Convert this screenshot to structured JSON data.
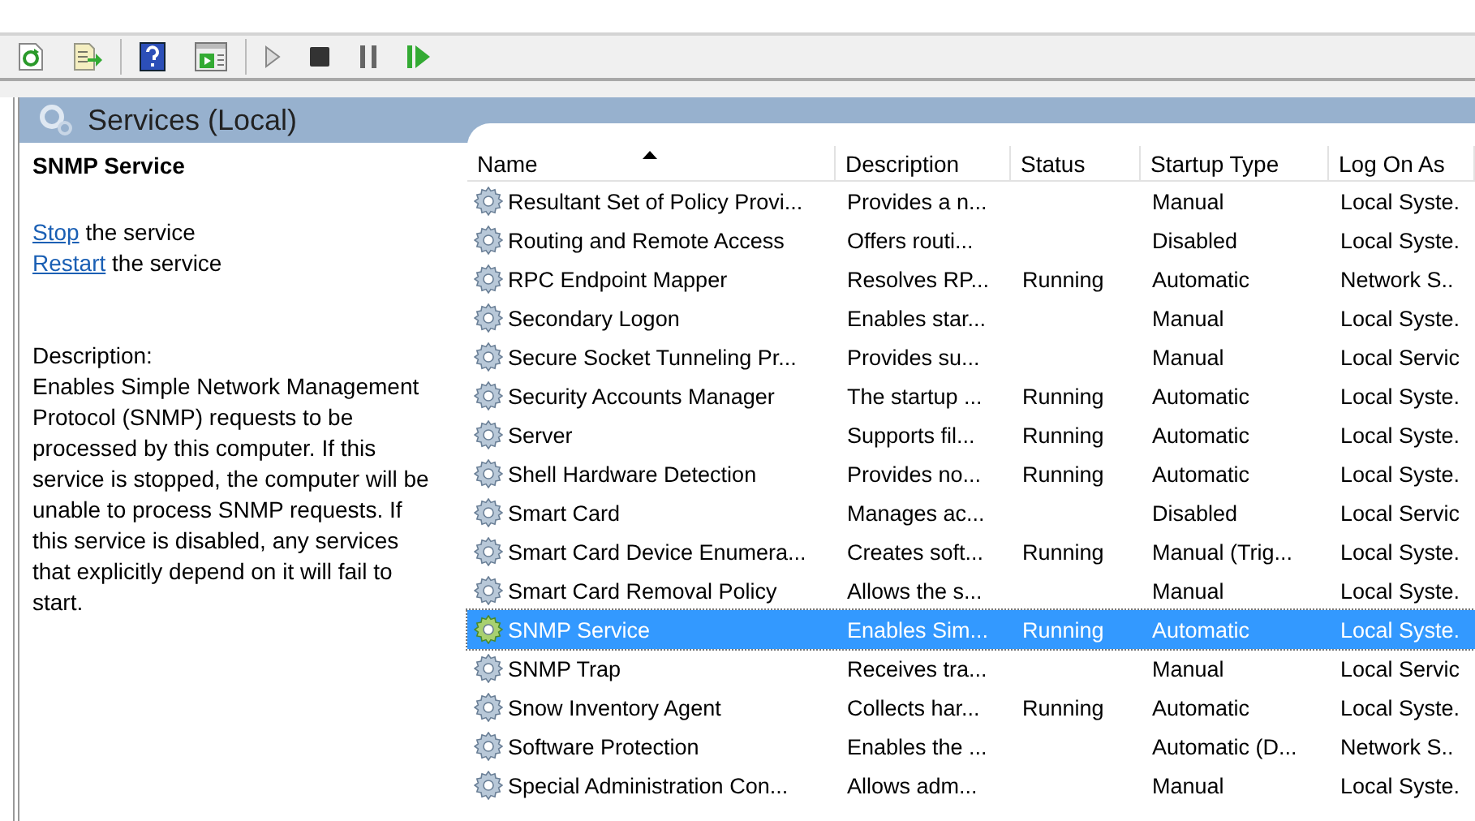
{
  "toolbar": {
    "buttons": [
      {
        "kind": "refresh"
      },
      {
        "kind": "export"
      },
      {
        "kind": "help"
      },
      {
        "kind": "console"
      },
      {
        "kind": "start"
      },
      {
        "kind": "stop"
      },
      {
        "kind": "pause"
      },
      {
        "kind": "resume"
      }
    ]
  },
  "panel": {
    "title": "Services (Local)"
  },
  "details": {
    "service_name": "SNMP Service",
    "actions": [
      {
        "link": "Stop",
        "text": "the service"
      },
      {
        "link": "Restart",
        "text": "the service"
      }
    ],
    "description_label": "Description:",
    "description": "Enables Simple Network Management Protocol (SNMP) requests to be processed by this computer. If this service is stopped, the computer will be unable to process SNMP requests. If this service is disabled, any services that explicitly depend on it will fail to start."
  },
  "table": {
    "columns": [
      {
        "label": "Name",
        "sorted": true
      },
      {
        "label": "Description",
        "sorted": false
      },
      {
        "label": "Status",
        "sorted": false
      },
      {
        "label": "Startup Type",
        "sorted": false
      },
      {
        "label": "Log On As",
        "sorted": false
      }
    ],
    "rows": [
      {
        "name": "Resultant Set of Policy Provi...",
        "description": "Provides a n...",
        "startup_type": "Manual",
        "log_on_as": "Local Syste.",
        "selected": false
      },
      {
        "name": "Routing and Remote Access",
        "description": "Offers routi...",
        "startup_type": "Disabled",
        "log_on_as": "Local Syste.",
        "selected": false
      },
      {
        "name": "RPC Endpoint Mapper",
        "description": "Resolves RP...",
        "status": "Running",
        "startup_type": "Automatic",
        "log_on_as": "Network S..",
        "selected": false
      },
      {
        "name": "Secondary Logon",
        "description": "Enables star...",
        "startup_type": "Manual",
        "log_on_as": "Local Syste.",
        "selected": false
      },
      {
        "name": "Secure Socket Tunneling Pr...",
        "description": "Provides su...",
        "startup_type": "Manual",
        "log_on_as": "Local Servic",
        "selected": false
      },
      {
        "name": "Security Accounts Manager",
        "description": "The startup ...",
        "status": "Running",
        "startup_type": "Automatic",
        "log_on_as": "Local Syste.",
        "selected": false
      },
      {
        "name": "Server",
        "description": "Supports fil...",
        "status": "Running",
        "startup_type": "Automatic",
        "log_on_as": "Local Syste.",
        "selected": false
      },
      {
        "name": "Shell Hardware Detection",
        "description": "Provides no...",
        "status": "Running",
        "startup_type": "Automatic",
        "log_on_as": "Local Syste.",
        "selected": false
      },
      {
        "name": "Smart Card",
        "description": "Manages ac...",
        "startup_type": "Disabled",
        "log_on_as": "Local Servic",
        "selected": false
      },
      {
        "name": "Smart Card Device Enumera...",
        "description": "Creates soft...",
        "status": "Running",
        "startup_type": "Manual (Trig...",
        "log_on_as": "Local Syste.",
        "selected": false
      },
      {
        "name": "Smart Card Removal Policy",
        "description": "Allows the s...",
        "startup_type": "Manual",
        "log_on_as": "Local Syste.",
        "selected": false
      },
      {
        "name": "SNMP Service",
        "description": "Enables Sim...",
        "status": "Running",
        "startup_type": "Automatic",
        "log_on_as": "Local Syste.",
        "selected": true
      },
      {
        "name": "SNMP Trap",
        "description": "Receives tra...",
        "startup_type": "Manual",
        "log_on_as": "Local Servic",
        "selected": false
      },
      {
        "name": "Snow Inventory Agent",
        "description": "Collects har...",
        "status": "Running",
        "startup_type": "Automatic",
        "log_on_as": "Local Syste.",
        "selected": false
      },
      {
        "name": "Software Protection",
        "description": "Enables the ...",
        "startup_type": "Automatic (D...",
        "log_on_as": "Network S..",
        "selected": false
      },
      {
        "name": "Special Administration Con...",
        "description": "Allows adm...",
        "startup_type": "Manual",
        "log_on_as": "Local Syste.",
        "selected": false
      }
    ]
  }
}
